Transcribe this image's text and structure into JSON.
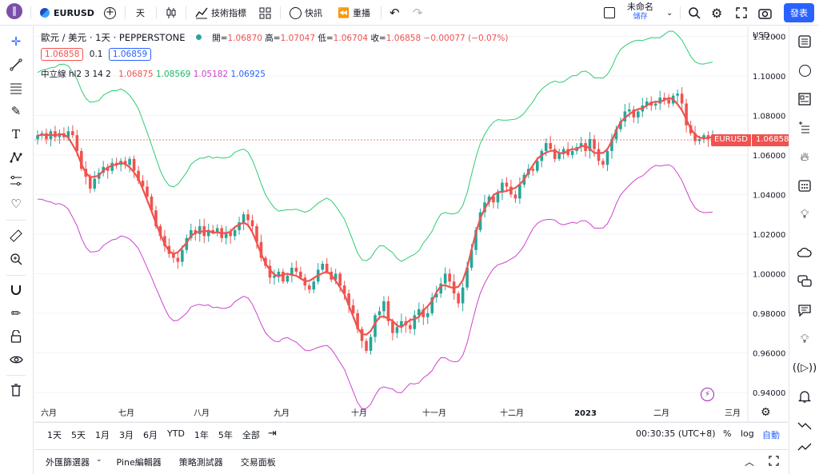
{
  "topbar": {
    "symbol": "EURUSD",
    "interval": "天",
    "indicators_label": "技術指標",
    "replay_label": "快訊",
    "rewind_label": "重播",
    "layout_name": "未命名",
    "save_label": "儲存",
    "publish_label": "發表"
  },
  "legend": {
    "title": "歐元 / 美元 · 1天 · PEPPERSTONE",
    "open_label": "開=",
    "open": "1.06870",
    "high_label": "高=",
    "high": "1.07047",
    "low_label": "低=",
    "low": "1.06704",
    "close_label": "收=",
    "close": "1.06858",
    "change": "−0.00077 (−0.07%)",
    "bid": "1.06858",
    "spread": "0.1",
    "ask": "1.06859",
    "indicator_name": "中立線 hl2 3 14 2",
    "ind_v1": "1.06875",
    "ind_v2": "1.08569",
    "ind_v3": "1.05182",
    "ind_v4": "1.06925"
  },
  "price_axis": {
    "currency": "USD",
    "last_price_tag_symbol": "EURUSD",
    "last_price_tag_value": "1.06858"
  },
  "time_axis": {
    "labels": [
      "六月",
      "七月",
      "八月",
      "九月",
      "十月",
      "十一月",
      "十二月",
      "2023",
      "二月",
      "三月"
    ]
  },
  "ranges": [
    "1天",
    "5天",
    "1月",
    "3月",
    "6月",
    "YTD",
    "1年",
    "5年",
    "全部"
  ],
  "bottom_status": {
    "clock": "00:30:35 (UTC+8)",
    "percent_label": "%",
    "log_label": "log",
    "auto_label": "自動"
  },
  "bottom_tabs": [
    "外匯篩選器",
    "Pine編輯器",
    "策略測試器",
    "交易面板"
  ],
  "colors": {
    "up": "#26a69a",
    "down": "#ef5350",
    "upper_band": "#2ecc71",
    "lower_band": "#cc44cc",
    "accent": "#2962ff"
  },
  "chart_data": {
    "type": "candlestick",
    "ylim": [
      0.925,
      1.125
    ],
    "yticks": [
      "1.12000",
      "1.10000",
      "1.08000",
      "1.06000",
      "1.04000",
      "1.02000",
      "1.00000",
      "0.98000",
      "0.96000",
      "0.94000"
    ],
    "ytick_values": [
      1.12,
      1.1,
      1.08,
      1.06,
      1.04,
      1.02,
      1.0,
      0.98,
      0.96,
      0.94
    ],
    "close_series": [
      1.07,
      1.071,
      1.068,
      1.072,
      1.069,
      1.071,
      1.069,
      1.072,
      1.07,
      1.062,
      1.053,
      1.049,
      1.043,
      1.048,
      1.051,
      1.054,
      1.052,
      1.056,
      1.055,
      1.057,
      1.055,
      1.058,
      1.052,
      1.047,
      1.044,
      1.039,
      1.032,
      1.024,
      1.019,
      1.014,
      1.01,
      1.008,
      1.006,
      1.012,
      1.018,
      1.022,
      1.02,
      1.024,
      1.019,
      1.022,
      1.021,
      1.023,
      1.018,
      1.021,
      1.019,
      1.022,
      1.026,
      1.03,
      1.027,
      1.024,
      1.016,
      1.008,
      1.004,
      0.998,
      0.999,
      1.001,
      0.996,
      0.999,
      1.003,
      1.001,
      0.998,
      0.994,
      0.992,
      0.996,
      1.002,
      1.005,
      1.001,
      0.997,
      1.0,
      0.994,
      0.99,
      0.984,
      0.98,
      0.972,
      0.966,
      0.961,
      0.968,
      0.979,
      0.981,
      0.986,
      0.976,
      0.97,
      0.973,
      0.976,
      0.974,
      0.972,
      0.979,
      0.982,
      0.978,
      0.98,
      0.988,
      0.99,
      0.995,
      1.0,
      0.996,
      0.99,
      0.985,
      0.993,
      1.003,
      1.012,
      1.022,
      1.031,
      1.036,
      1.039,
      1.036,
      1.041,
      1.046,
      1.044,
      1.04,
      1.038,
      1.045,
      1.05,
      1.053,
      1.052,
      1.057,
      1.062,
      1.066,
      1.063,
      1.058,
      1.061,
      1.063,
      1.06,
      1.062,
      1.064,
      1.066,
      1.062,
      1.068,
      1.063,
      1.057,
      1.055,
      1.062,
      1.068,
      1.073,
      1.077,
      1.082,
      1.083,
      1.079,
      1.082,
      1.085,
      1.087,
      1.085,
      1.086,
      1.089,
      1.088,
      1.086,
      1.09,
      1.091,
      1.086,
      1.075,
      1.071,
      1.067,
      1.068,
      1.07,
      1.068,
      1.069
    ]
  }
}
